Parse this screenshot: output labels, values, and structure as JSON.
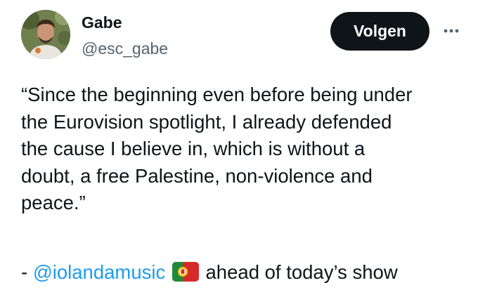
{
  "user": {
    "name": "Gabe",
    "handle": "@esc_gabe"
  },
  "actions": {
    "follow_label": "Volgen",
    "more_icon": "more-horizontal-icon"
  },
  "tweet": {
    "text": "“Since the beginning even before being under\nthe Eurovision spotlight, I already defended\nthe cause I believe in, which is without a\ndoubt, a free Palestine, non-violence and\npeace.”",
    "credit_prefix": "- ",
    "mention": "@iolandamusic",
    "flag_icon": "portugal-flag-icon",
    "credit_suffix": " ahead of today’s show"
  },
  "colors": {
    "text": "#0f1419",
    "secondary": "#536471",
    "link": "#1d9bf0",
    "button_bg": "#0f1419"
  }
}
